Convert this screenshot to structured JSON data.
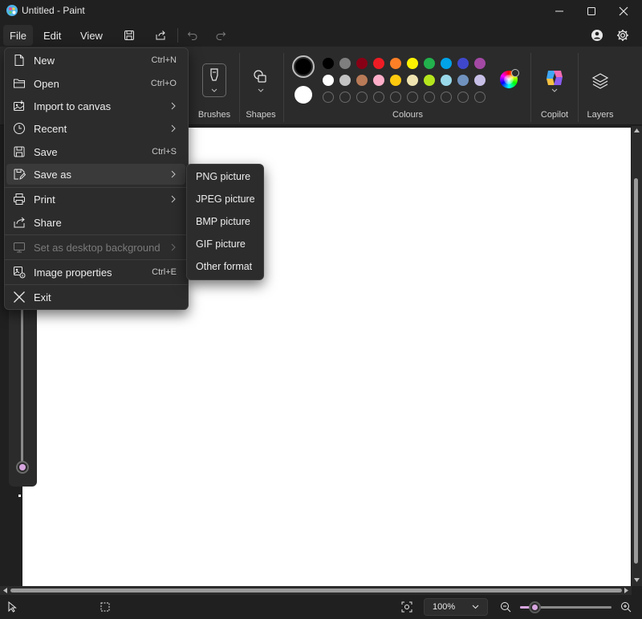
{
  "window": {
    "title": "Untitled - Paint"
  },
  "menubar": {
    "file": "File",
    "edit": "Edit",
    "view": "View"
  },
  "ribbon": {
    "brushes_label": "Brushes",
    "shapes_label": "Shapes",
    "colours_label": "Colours",
    "copilot_label": "Copilot",
    "layers_label": "Layers",
    "primary_colour": "#000000",
    "secondary_colour": "#ffffff",
    "palette_row1": [
      "#000000",
      "#7f7f7f",
      "#880015",
      "#ed1c24",
      "#ff7f27",
      "#fff200",
      "#22b14c",
      "#00a2e8",
      "#3f48cc",
      "#a349a4"
    ],
    "palette_row2": [
      "#ffffff",
      "#c3c3c3",
      "#b97a57",
      "#ffaec9",
      "#ffc90e",
      "#efe4b0",
      "#b5e61d",
      "#99d9ea",
      "#7092be",
      "#c8bfe7"
    ],
    "palette_row3_empty_count": 10
  },
  "file_menu": {
    "items": [
      {
        "label": "New",
        "shortcut": "Ctrl+N",
        "icon": "new-file-icon"
      },
      {
        "label": "Open",
        "shortcut": "Ctrl+O",
        "icon": "folder-icon"
      },
      {
        "label": "Import to canvas",
        "icon": "import-icon"
      },
      {
        "label": "Recent",
        "icon": "clock-icon"
      },
      {
        "label": "Save",
        "shortcut": "Ctrl+S",
        "icon": "save-icon"
      },
      {
        "label": "Save as",
        "icon": "save-as-icon"
      },
      {
        "label": "Print",
        "icon": "printer-icon"
      },
      {
        "label": "Share",
        "icon": "share-icon"
      },
      {
        "label": "Set as desktop background",
        "icon": "desktop-icon"
      },
      {
        "label": "Image properties",
        "shortcut": "Ctrl+E",
        "icon": "image-properties-icon"
      },
      {
        "label": "Exit",
        "icon": "close-icon"
      }
    ]
  },
  "save_as_submenu": {
    "items": [
      "PNG picture",
      "JPEG picture",
      "BMP picture",
      "GIF picture",
      "Other format"
    ]
  },
  "statusbar": {
    "zoom": "100%",
    "zoom_fraction": 0.16
  },
  "accent_colour": "#d7a6e0"
}
